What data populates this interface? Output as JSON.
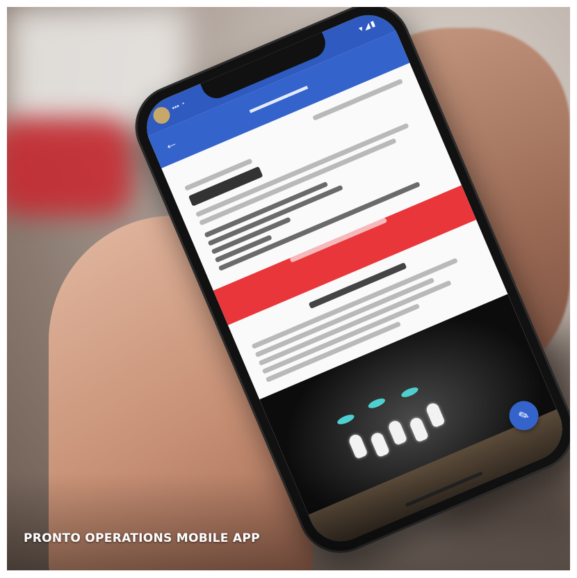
{
  "caption": "PRONTO OPERATIONS MOBILE APP",
  "colors": {
    "app_bar": "#3463cc",
    "action_button": "#e8363b",
    "caption_text": "#ffffff"
  },
  "icons": {
    "back": "arrow-left-icon",
    "fab": "wrench-icon"
  }
}
